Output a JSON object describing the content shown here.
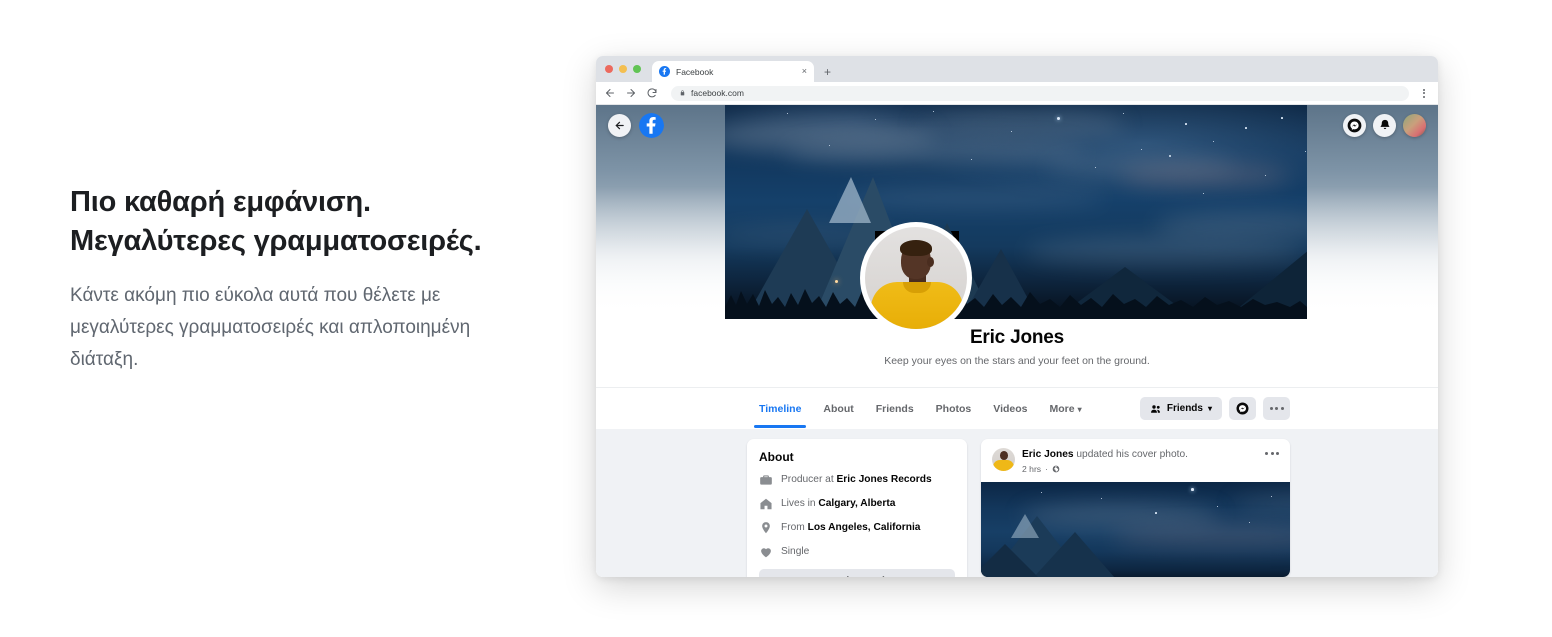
{
  "promo": {
    "title": "Πιο καθαρή εμφάνιση. Μεγαλύτερες γραμματοσειρές.",
    "body": "Κάντε ακόμη πιο εύκολα αυτά που θέλετε με μεγαλύτερες γραμματοσειρές και απλοποιημένη διάταξη."
  },
  "browser": {
    "tab_title": "Facebook",
    "tab_close": "×",
    "new_tab": "+",
    "url": "facebook.com",
    "back_icon": "back-arrow-icon",
    "forward_icon": "forward-arrow-icon",
    "reload_icon": "reload-icon",
    "lock_icon": "lock-icon",
    "menu_icon": "kebab-menu-icon"
  },
  "fb_nav": {
    "back_icon": "back-arrow-icon",
    "logo_icon": "facebook-logo-icon",
    "messenger_icon": "messenger-icon",
    "notifications_icon": "bell-icon",
    "account_icon": "account-avatar"
  },
  "profile": {
    "name": "Eric Jones",
    "bio": "Keep your eyes on the stars and your feet on the ground."
  },
  "tabs": [
    {
      "label": "Timeline",
      "active": true
    },
    {
      "label": "About",
      "active": false
    },
    {
      "label": "Friends",
      "active": false
    },
    {
      "label": "Photos",
      "active": false
    },
    {
      "label": "Videos",
      "active": false
    },
    {
      "label": "More",
      "active": false,
      "caret": "▾"
    }
  ],
  "actions": {
    "friends_label": "Friends",
    "friends_caret": "▾",
    "friends_icon": "friends-people-icon",
    "message_icon": "messenger-icon",
    "more_icon": "ellipsis-icon"
  },
  "about": {
    "title": "About",
    "rows": [
      {
        "icon": "briefcase-icon",
        "prefix": "Producer at ",
        "value": "Eric Jones Records"
      },
      {
        "icon": "home-icon",
        "prefix": "Lives in ",
        "value": "Calgary, Alberta"
      },
      {
        "icon": "location-pin-icon",
        "prefix": "From ",
        "value": "Los Angeles, California"
      },
      {
        "icon": "heart-icon",
        "prefix": "",
        "value": "Single"
      }
    ],
    "see_more_label": "See More About Eric Jones"
  },
  "post": {
    "author": "Eric Jones",
    "action_text": " updated his cover photo.",
    "time": "2 hrs",
    "separator": "·",
    "privacy_icon": "globe-icon",
    "menu_icon": "ellipsis-icon",
    "image_name": "night-mountain-cover-photo"
  },
  "colors": {
    "accent": "#1877f2",
    "text_primary": "#050505",
    "text_secondary": "#65676b",
    "surface": "#ffffff",
    "page_bg": "#f0f2f5",
    "button_bg": "#e4e6eb"
  }
}
